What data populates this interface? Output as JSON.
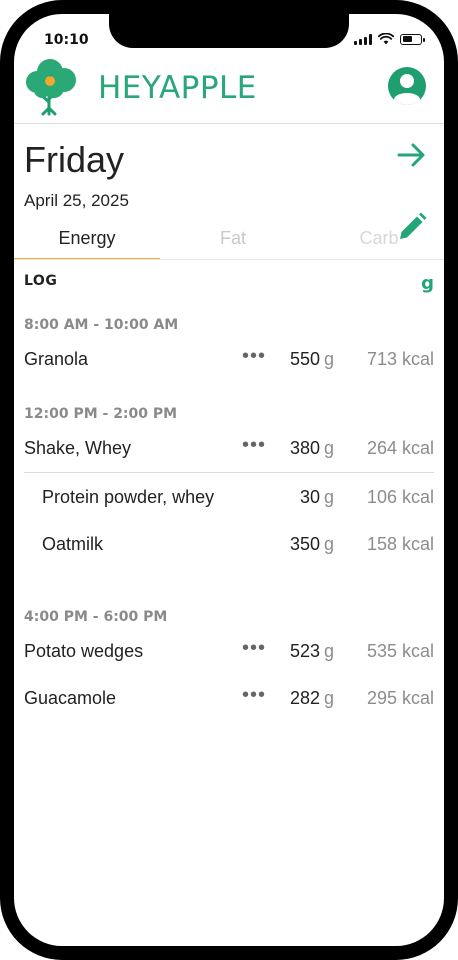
{
  "status_bar": {
    "time": "10:10"
  },
  "header": {
    "brand_bold": "HEY",
    "brand_light": "APPLE"
  },
  "day": {
    "name": "Friday",
    "date": "April 25, 2025"
  },
  "tabs": [
    {
      "label": "Energy",
      "active": true
    },
    {
      "label": "Fat",
      "active": false
    },
    {
      "label": "Carb",
      "active": false
    }
  ],
  "log": {
    "label": "LOG",
    "unit_toggle": "g",
    "sections": [
      {
        "time": "8:00 AM - 10:00 AM",
        "items": [
          {
            "name": "Granola",
            "amount": "550",
            "unit": "g",
            "kcal": "713 kcal"
          }
        ]
      },
      {
        "time": "12:00 PM - 2:00 PM",
        "items": [
          {
            "name": "Shake, Whey",
            "amount": "380",
            "unit": "g",
            "kcal": "264 kcal"
          },
          {
            "name": "Protein powder, whey",
            "amount": "30",
            "unit": "g",
            "kcal": "106 kcal"
          },
          {
            "name": "Oatmilk",
            "amount": "350",
            "unit": "g",
            "kcal": "158 kcal"
          }
        ]
      },
      {
        "time": "4:00 PM - 6:00 PM",
        "items": [
          {
            "name": "Potato wedges",
            "amount": "523",
            "unit": "g",
            "kcal": "535 kcal"
          },
          {
            "name": "Guacamole",
            "amount": "282",
            "unit": "g",
            "kcal": "295 kcal"
          }
        ]
      }
    ]
  },
  "more_glyph": "•••",
  "colors": {
    "brand_green": "#29a77a",
    "tab_indicator": "#e9b33a"
  }
}
